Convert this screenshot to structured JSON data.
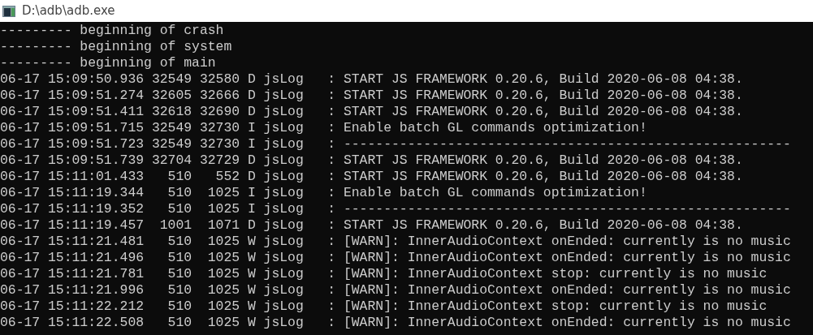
{
  "window": {
    "title": "D:\\adb\\adb.exe"
  },
  "console": {
    "lines": [
      "--------- beginning of crash",
      "--------- beginning of system",
      "--------- beginning of main",
      "06-17 15:09:50.936 32549 32580 D jsLog   : START JS FRAMEWORK 0.20.6, Build 2020-06-08 04:38.",
      "06-17 15:09:51.274 32605 32666 D jsLog   : START JS FRAMEWORK 0.20.6, Build 2020-06-08 04:38.",
      "06-17 15:09:51.411 32618 32690 D jsLog   : START JS FRAMEWORK 0.20.6, Build 2020-06-08 04:38.",
      "06-17 15:09:51.715 32549 32730 I jsLog   : Enable batch GL commands optimization!",
      "06-17 15:09:51.723 32549 32730 I jsLog   : --------------------------------------------------------",
      "06-17 15:09:51.739 32704 32729 D jsLog   : START JS FRAMEWORK 0.20.6, Build 2020-06-08 04:38.",
      "06-17 15:11:01.433   510   552 D jsLog   : START JS FRAMEWORK 0.20.6, Build 2020-06-08 04:38.",
      "06-17 15:11:19.344   510  1025 I jsLog   : Enable batch GL commands optimization!",
      "06-17 15:11:19.352   510  1025 I jsLog   : --------------------------------------------------------",
      "06-17 15:11:19.457  1001  1071 D jsLog   : START JS FRAMEWORK 0.20.6, Build 2020-06-08 04:38.",
      "06-17 15:11:21.481   510  1025 W jsLog   : [WARN]: InnerAudioContext onEnded: currently is no music",
      "06-17 15:11:21.496   510  1025 W jsLog   : [WARN]: InnerAudioContext onEnded: currently is no music",
      "06-17 15:11:21.781   510  1025 W jsLog   : [WARN]: InnerAudioContext stop: currently is no music",
      "06-17 15:11:21.996   510  1025 W jsLog   : [WARN]: InnerAudioContext onEnded: currently is no music",
      "06-17 15:11:22.212   510  1025 W jsLog   : [WARN]: InnerAudioContext stop: currently is no music",
      "06-17 15:11:22.508   510  1025 W jsLog   : [WARN]: InnerAudioContext onEnded: currently is no music"
    ]
  }
}
